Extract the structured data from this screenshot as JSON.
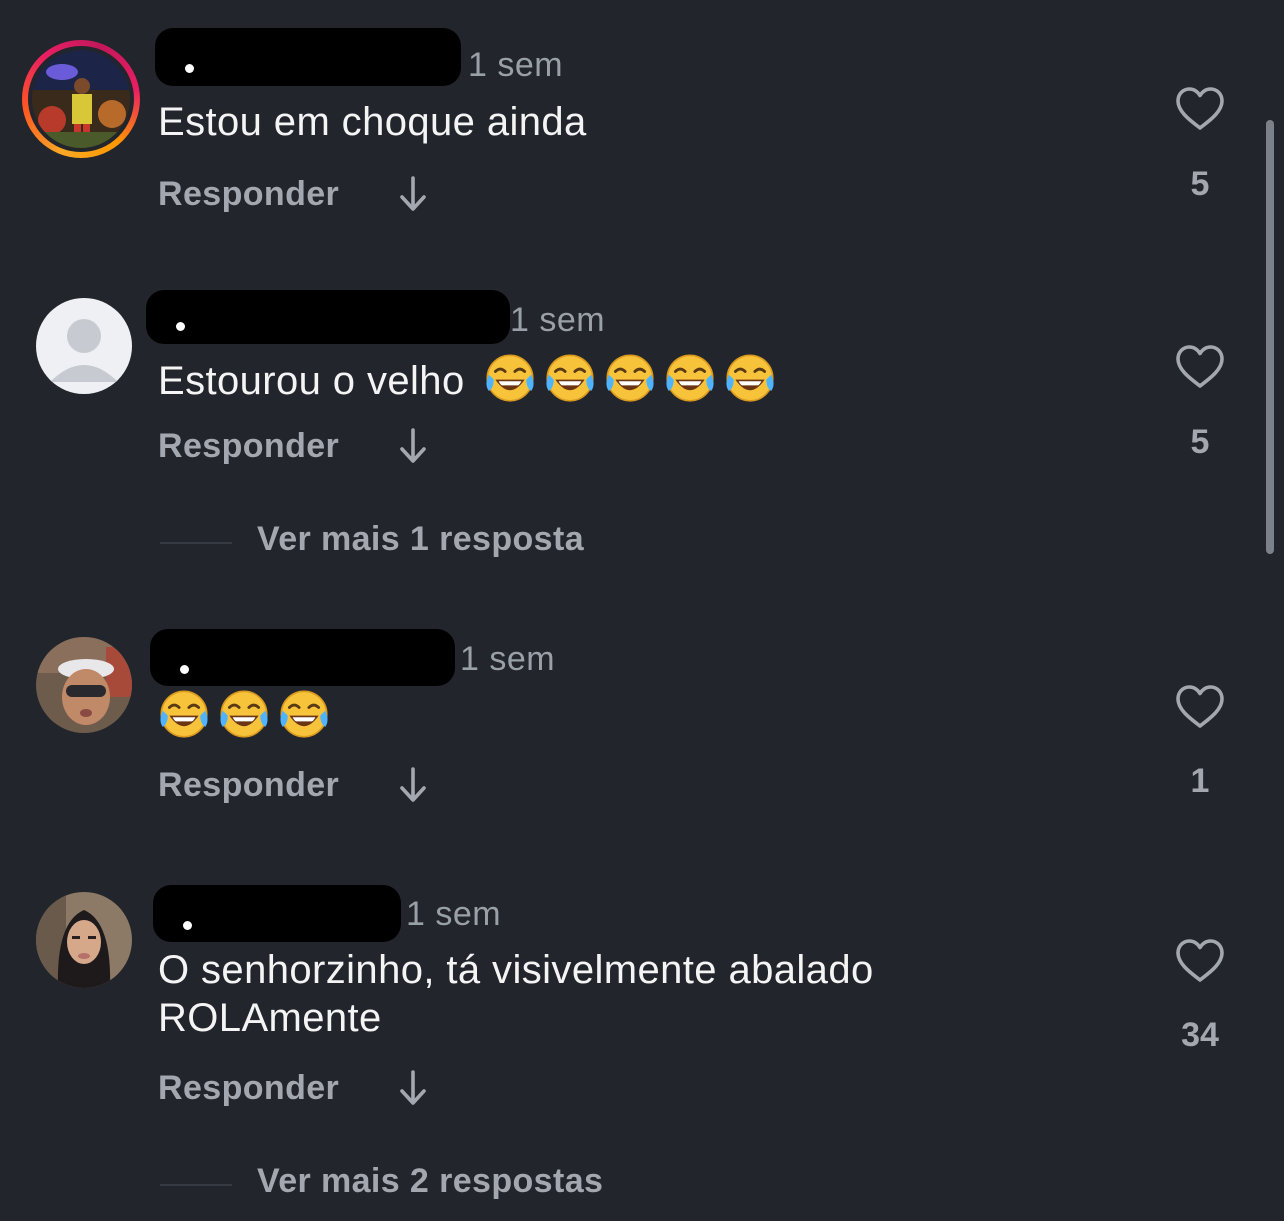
{
  "comments": [
    {
      "time": "1 sem",
      "text": "Estou em choque ainda",
      "reply": "Responder",
      "likes": "5"
    },
    {
      "time": "1 sem",
      "text": "Estourou o velho",
      "reply": "Responder",
      "likes": "5",
      "more_replies": "Ver mais 1 resposta"
    },
    {
      "time": "1 sem",
      "text": "",
      "reply": "Responder",
      "likes": "1"
    },
    {
      "time": "1 sem",
      "text_line1": "O senhorzinho, tá visivelmente abalado",
      "text_line2": "ROLAmente",
      "reply": "Responder",
      "likes": "34",
      "more_replies": "Ver mais 2 respostas"
    }
  ],
  "icons": {
    "like": "heart-icon",
    "expand": "arrow-down-icon",
    "emoji": "face-with-tears-of-joy"
  },
  "colors": {
    "background": "#22252c",
    "secondary_text": "#a3a8b0",
    "primary_text": "#f4f4f4"
  }
}
